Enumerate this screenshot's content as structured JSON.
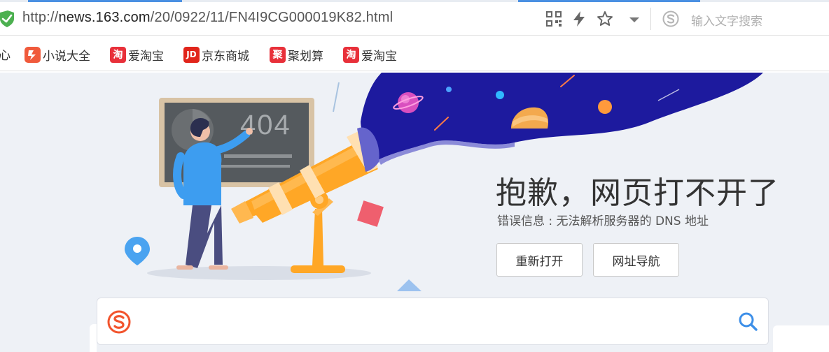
{
  "browser": {
    "url_prefix": "http://",
    "url_host": "news.163.com",
    "url_path": "/20/0922/11/FN4I9CG000019K82.html",
    "search_placeholder": "输入文字搜索"
  },
  "bookmarks": {
    "cut_label": "心",
    "items": [
      {
        "label": "小说大全",
        "icon": "novel-icon",
        "icon_color": "#f05a3c"
      },
      {
        "label": "爱淘宝",
        "icon": "taobao-icon",
        "icon_glyph": "淘",
        "icon_color": "#e8303a"
      },
      {
        "label": "京东商城",
        "icon": "jd-icon",
        "icon_glyph": "JD",
        "icon_color": "#e1251b"
      },
      {
        "label": "聚划算",
        "icon": "juhuasuan-icon",
        "icon_glyph": "聚",
        "icon_color": "#e8303a"
      },
      {
        "label": "爱淘宝",
        "icon": "taobao-icon",
        "icon_glyph": "淘",
        "icon_color": "#e8303a"
      }
    ]
  },
  "error_page": {
    "board_text": "404",
    "title": "抱歉，网页打不开了",
    "info": "错误信息 : 无法解析服务器的 DNS 地址",
    "buttons": {
      "reopen": "重新打开",
      "nav": "网址导航"
    }
  },
  "colors": {
    "accent": "#4a90e2",
    "sky": "#1d1a9e",
    "telescope": "#ffa726"
  }
}
